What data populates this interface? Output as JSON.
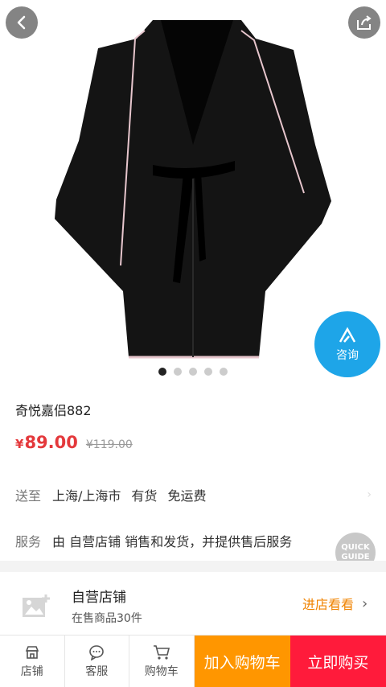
{
  "product": {
    "title": "奇悦嘉侣882",
    "price_symbol": "¥",
    "price": "89.00",
    "original_price": "¥119.00",
    "image_count": 5,
    "active_image_index": 0
  },
  "consult": {
    "label": "咨询"
  },
  "shipping": {
    "label": "送至",
    "location": "上海/上海市",
    "stock": "有货",
    "fee": "免运费"
  },
  "service": {
    "label": "服务",
    "text": "由 自营店铺 销售和发货，并提供售后服务"
  },
  "quick_guide": {
    "line1": "QUICK",
    "line2": "GUIDE"
  },
  "store": {
    "name": "自营店铺",
    "count_text": "在售商品30件",
    "enter_label": "进店看看"
  },
  "bottom_bar": {
    "store_label": "店铺",
    "service_label": "客服",
    "cart_label": "购物车",
    "add_to_cart_label": "加入购物车",
    "buy_now_label": "立即购买"
  },
  "colors": {
    "price_red": "#e4393c",
    "consult_blue": "#1ea5e8",
    "add_to_cart_orange": "#ff9600",
    "buy_now_red": "#ff1b3b",
    "store_enter_orange": "#f08300"
  },
  "icons": [
    "back-arrow-icon",
    "share-icon",
    "consult-icon",
    "store-icon",
    "chat-icon",
    "cart-icon",
    "image-placeholder-icon",
    "chevron-right-icon"
  ]
}
